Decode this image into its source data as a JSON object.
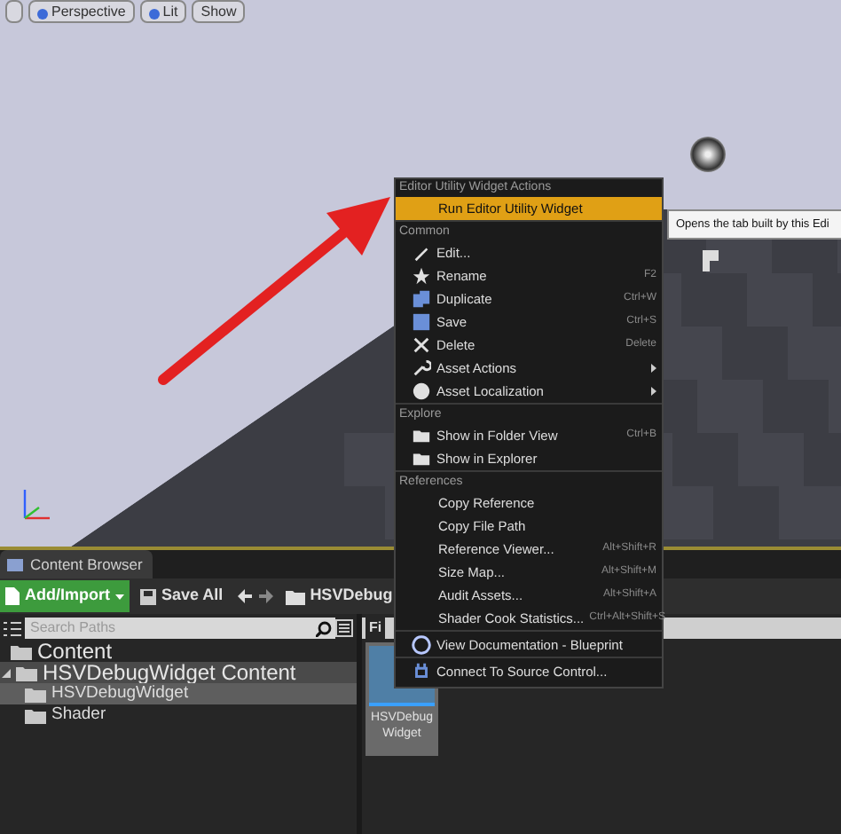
{
  "viewport": {
    "toolbar": [
      {
        "label": "Perspective"
      },
      {
        "label": "Lit"
      },
      {
        "label": "Show"
      }
    ]
  },
  "context_menu": {
    "sections": [
      {
        "header": "Editor Utility Widget Actions",
        "items": [
          {
            "label": "Run Editor Utility Widget",
            "selected": true
          }
        ]
      },
      {
        "header": "Common",
        "items": [
          {
            "label": "Edit...",
            "selected": false
          },
          {
            "label": "Rename",
            "shortcut": "F2",
            "selected": false
          },
          {
            "label": "Duplicate",
            "shortcut": "Ctrl+W",
            "selected": false
          },
          {
            "label": "Save",
            "shortcut": "Ctrl+S",
            "selected": false
          },
          {
            "label": "Delete",
            "shortcut": "Delete",
            "selected": false
          },
          {
            "label": "Asset Actions",
            "submenu": true,
            "selected": false
          },
          {
            "label": "Asset Localization",
            "submenu": true,
            "selected": false
          }
        ]
      },
      {
        "header": "Explore",
        "items": [
          {
            "label": "Show in Folder View",
            "shortcut": "Ctrl+B",
            "selected": false
          },
          {
            "label": "Show in Explorer",
            "selected": false
          }
        ]
      },
      {
        "header": "References",
        "items": [
          {
            "label": "Copy Reference",
            "selected": false
          },
          {
            "label": "Copy File Path",
            "selected": false
          },
          {
            "label": "Reference Viewer...",
            "shortcut": "Alt+Shift+R",
            "selected": false
          },
          {
            "label": "Size Map...",
            "shortcut": "Alt+Shift+M",
            "selected": false
          },
          {
            "label": "Audit Assets...",
            "shortcut": "Alt+Shift+A",
            "selected": false
          },
          {
            "label": "Shader Cook Statistics...",
            "shortcut": "Ctrl+Alt+Shift+S",
            "selected": false
          }
        ]
      },
      {
        "items": [
          {
            "label": "View Documentation - Blueprint",
            "selected": false
          }
        ]
      },
      {
        "items": [
          {
            "label": "Connect To Source Control...",
            "selected": false
          }
        ]
      }
    ]
  },
  "tooltip": "Opens the tab built by this Edi",
  "content_browser": {
    "tab": "Content Browser",
    "toolbar": {
      "add_button": "Add/Import",
      "save_button": "Save All",
      "path": "HSVDebug"
    },
    "search": {
      "placeholder": "Search Paths"
    },
    "tree": [
      {
        "label": "Content",
        "selected": false
      },
      {
        "label": "HSVDebugWidget Content",
        "expanded": true,
        "selected": false,
        "children": [
          {
            "label": "HSVDebugWidget",
            "selected": true
          },
          {
            "label": "Shader",
            "selected": false
          }
        ]
      }
    ],
    "filter_label": "Fi",
    "assets": [
      {
        "label": "HSVDebug Widget",
        "selected": true
      }
    ]
  }
}
